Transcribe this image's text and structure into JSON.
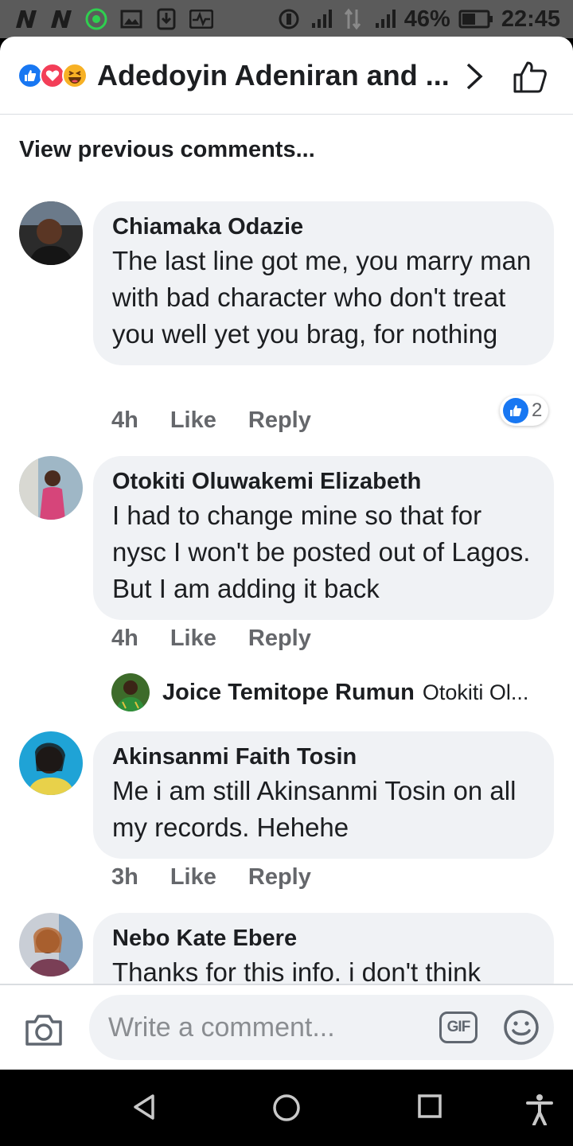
{
  "status_bar": {
    "battery_percent": "46%",
    "time": "22:45",
    "icons": [
      "notification-n-icon",
      "notification-n-icon",
      "whatsapp-icon",
      "gallery-icon",
      "download-icon",
      "activity-icon",
      "hotspot-icon",
      "signal-icon",
      "data-arrows-icon",
      "signal-icon",
      "battery-icon"
    ]
  },
  "header": {
    "reactions": [
      "like-reaction-icon",
      "love-reaction-icon",
      "haha-reaction-icon"
    ],
    "title": "Adedoyin Adeniran and ..."
  },
  "view_previous": "View previous comments...",
  "comments": [
    {
      "author": "Chiamaka Odazie",
      "text": "The last line got me, you marry man with bad character who don't treat you well yet you brag, for nothing",
      "time": "4h",
      "like_label": "Like",
      "reply_label": "Reply",
      "reaction_count": "2"
    },
    {
      "author": "Otokiti Oluwakemi Elizabeth",
      "text": "I had to change mine so that for nysc I  won't be posted out of Lagos. But I am adding it back",
      "time": "4h",
      "like_label": "Like",
      "reply_label": "Reply"
    },
    {
      "author": "Akinsanmi Faith Tosin",
      "text": "Me i am still Akinsanmi Tosin on all my records. Hehehe",
      "time": "3h",
      "like_label": "Like",
      "reply_label": "Reply"
    },
    {
      "author": "Nebo Kate Ebere",
      "text": "Thanks for this info. i don't think"
    }
  ],
  "reply_preview": {
    "author": "Joice Temitope Rumun",
    "text": "Otokiti Ol..."
  },
  "composer": {
    "placeholder": "Write a comment...",
    "gif_label": "GIF"
  },
  "colors": {
    "bubble": "#f0f2f5",
    "like_blue": "#1877f2",
    "meta_gray": "#65676b"
  }
}
